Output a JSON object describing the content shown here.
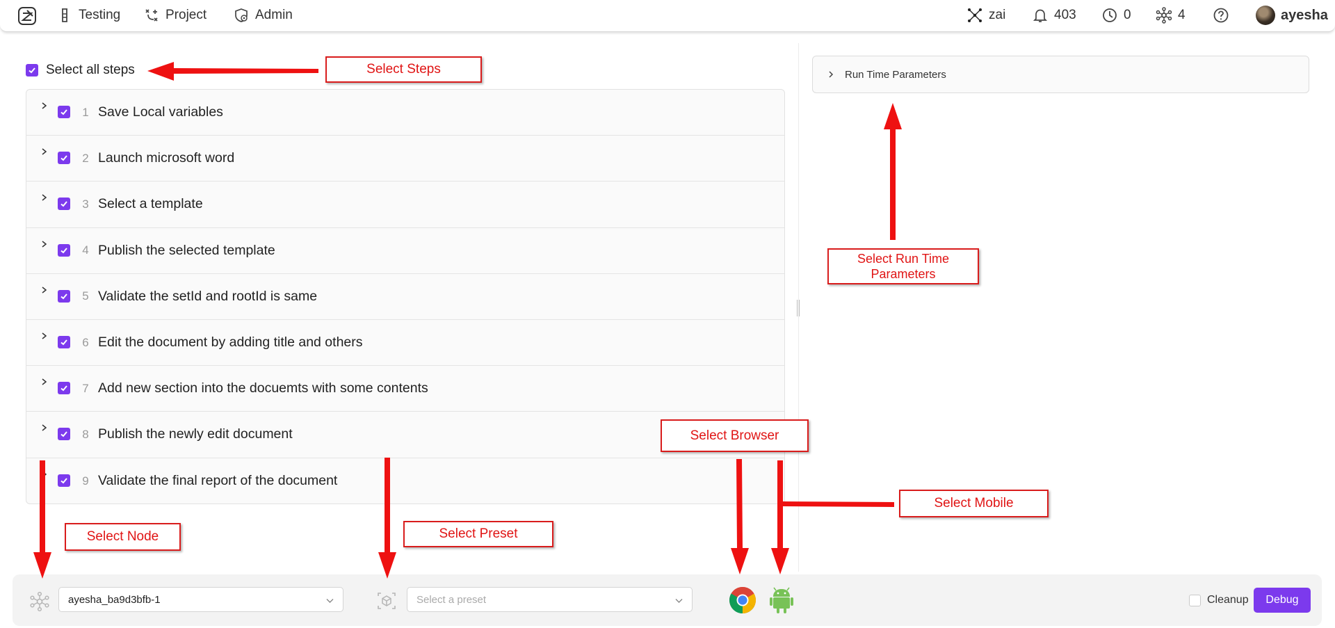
{
  "topnav": {
    "items": [
      {
        "label": "Testing",
        "icon": "flask-icon"
      },
      {
        "label": "Project",
        "icon": "project-flow-icon"
      },
      {
        "label": "Admin",
        "icon": "admin-shield-icon"
      }
    ],
    "zai_label": "zai",
    "notifications_count": "403",
    "history_count": "0",
    "nodes_count": "4",
    "user_name": "ayesha"
  },
  "steps_panel": {
    "select_all_label": "Select all steps",
    "steps": [
      {
        "num": "1",
        "title": "Save Local variables"
      },
      {
        "num": "2",
        "title": "Launch microsoft word"
      },
      {
        "num": "3",
        "title": "Select a template"
      },
      {
        "num": "4",
        "title": "Publish the selected template"
      },
      {
        "num": "5",
        "title": "Validate the setId and rootId is same"
      },
      {
        "num": "6",
        "title": "Edit the document by adding title and others"
      },
      {
        "num": "7",
        "title": "Add new section into the docuemts with some contents"
      },
      {
        "num": "8",
        "title": "Publish the newly edit document"
      },
      {
        "num": "9",
        "title": "Validate the final report of the document"
      }
    ]
  },
  "runtime": {
    "label": "Run Time Parameters"
  },
  "bottombar": {
    "node_value": "ayesha_ba9d3bfb-1",
    "preset_placeholder": "Select a preset",
    "cleanup_label": "Cleanup",
    "debug_label": "Debug"
  },
  "annotations": {
    "select_steps": "Select Steps",
    "select_runtime": "Select Run Time Parameters",
    "select_browser": "Select Browser",
    "select_mobile": "Select Mobile",
    "select_node": "Select Node",
    "select_preset": "Select Preset"
  },
  "colors": {
    "accent": "#7c3aed",
    "annotation_red": "#e01414"
  }
}
